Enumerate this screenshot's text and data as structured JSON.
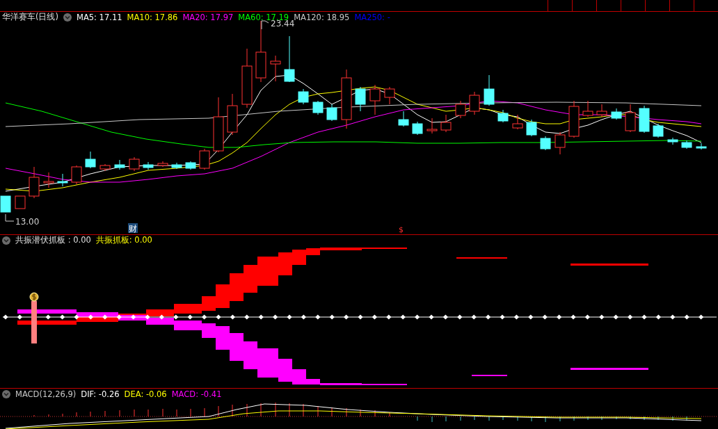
{
  "main_panel": {
    "title": "华洋赛车(日线)",
    "indicators": [
      {
        "text": "MA5: 17.11",
        "color": "#ffffff"
      },
      {
        "text": "MA10: 17.86",
        "color": "#ffff00"
      },
      {
        "text": "MA20: 17.97",
        "color": "#ff00ff"
      },
      {
        "text": "MA60: 17.19",
        "color": "#00ff00"
      },
      {
        "text": "MA120: 18.95",
        "color": "#c8c8c8"
      },
      {
        "text": "MA250: -",
        "color": "#0000ff"
      }
    ],
    "high_label": "23.44",
    "low_label": "13.00",
    "finance_marker": "财",
    "dividend_marker": "$"
  },
  "signal_panel": {
    "indicators": [
      {
        "text": "共振潜伏抓板 : 0.00",
        "color": "#e0e0e0"
      },
      {
        "text": "共振抓板: 0.00",
        "color": "#ffff00"
      }
    ]
  },
  "macd_panel": {
    "indicators": [
      {
        "text": "MACD(12,26,9)",
        "color": "#c8c8c8"
      },
      {
        "text": "DIF: -0.26",
        "color": "#ffffff"
      },
      {
        "text": "DEA: -0.06",
        "color": "#ffff00"
      },
      {
        "text": "MACD: -0.41",
        "color": "#ff00ff"
      }
    ]
  }
}
